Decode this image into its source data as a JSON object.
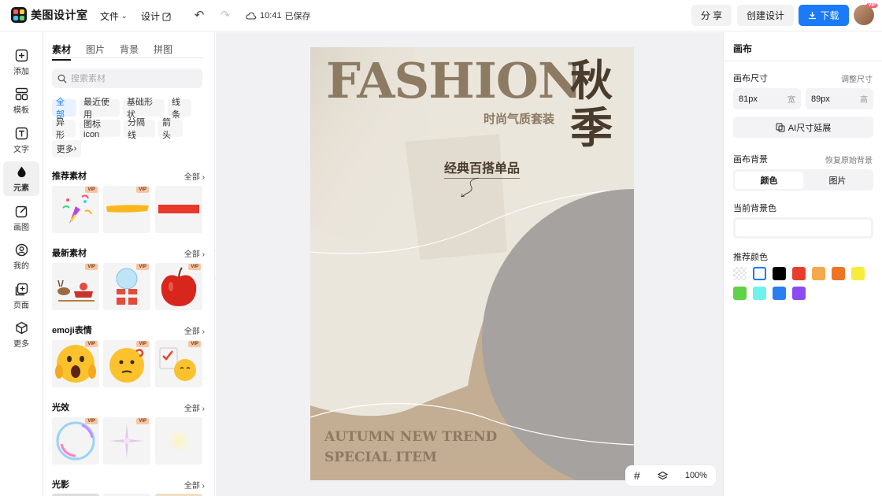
{
  "app": {
    "name": "美图设计室"
  },
  "topbar": {
    "file_label": "文件",
    "design_label": "设计",
    "save_time": "10:41",
    "save_status": "已保存",
    "share_label": "分 享",
    "create_label": "创建设计",
    "download_label": "下载",
    "avatar_badge": "VIP"
  },
  "rail": {
    "items": [
      {
        "label": "添加",
        "icon": "plus-square-icon"
      },
      {
        "label": "模板",
        "icon": "template-icon"
      },
      {
        "label": "文字",
        "icon": "text-icon"
      },
      {
        "label": "元素",
        "icon": "element-icon"
      },
      {
        "label": "画图",
        "icon": "draw-icon"
      },
      {
        "label": "我的",
        "icon": "user-icon"
      },
      {
        "label": "页面",
        "icon": "page-add-icon"
      },
      {
        "label": "更多",
        "icon": "cube-icon"
      }
    ],
    "active": "元素"
  },
  "panel": {
    "tabs": [
      "素材",
      "图片",
      "背景",
      "拼图"
    ],
    "search_placeholder": "搜索素材",
    "chips": [
      "全部",
      "最近使用",
      "基础形状",
      "线条",
      "异形",
      "图标icon",
      "分隔线",
      "箭头",
      "更多"
    ],
    "all_label": "全部",
    "vip_label": "VIP",
    "sections": [
      {
        "title": "推荐素材",
        "items": [
          "party-popper",
          "yellow-brush-stroke",
          "red-bar"
        ]
      },
      {
        "title": "最新素材",
        "items": [
          "reindeer-sleigh",
          "snow-globe-gift",
          "red-apple"
        ]
      },
      {
        "title": "emoji表情",
        "items": [
          "shocked-face",
          "thinking-face",
          "checklist-face"
        ]
      },
      {
        "title": "光效",
        "items": [
          "bubble",
          "sparkle",
          "glow"
        ]
      },
      {
        "title": "光影",
        "items": []
      }
    ]
  },
  "poster": {
    "title": "FASHION",
    "side_title": "秋季",
    "subtitle": "时尚气质套装",
    "tagline": "经典百搭单品",
    "footer_line1": "AUTUMN NEW TREND",
    "footer_line2": "SPECIAL ITEM"
  },
  "zoom": {
    "level": "100%"
  },
  "rpanel": {
    "title": "画布",
    "size_label": "画布尺寸",
    "size_link": "调整尺寸",
    "width_value": "81px",
    "width_unit": "宽",
    "height_value": "89px",
    "height_unit": "高",
    "ai_extend_label": "AI尺寸延展",
    "bg_label": "画布背景",
    "bg_reset": "恢复原始背景",
    "bg_tabs": [
      "颜色",
      "图片"
    ],
    "current_bg_label": "当前背景色",
    "recommend_label": "推荐颜色",
    "colors": [
      "transparent",
      "#ffffff",
      "#000000",
      "#e93d2b",
      "#f5a94a",
      "#ee7424",
      "#f6ec3d",
      "#5fd247",
      "#6ff2ec",
      "#2a7ff0",
      "#8a4cf0"
    ]
  }
}
